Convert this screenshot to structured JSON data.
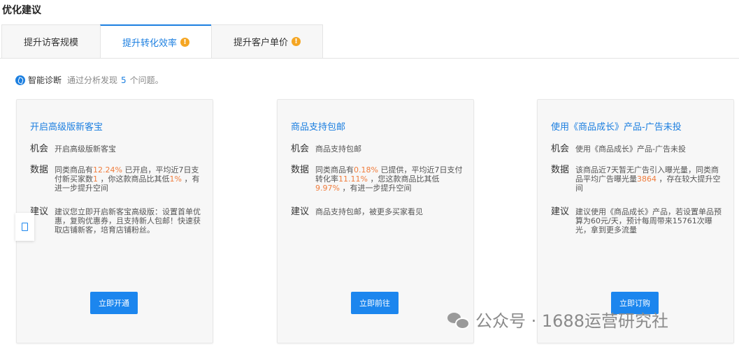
{
  "page_title": "优化建议",
  "tabs": [
    {
      "label": "提升访客规模",
      "warning": ""
    },
    {
      "label": "提升转化效率",
      "warning": "!"
    },
    {
      "label": "提升客户单价",
      "warning": "!"
    }
  ],
  "active_tab_index": 1,
  "diagnosis": {
    "label": "智能诊断",
    "prefix": "通过分析发现",
    "count": "5",
    "suffix": "个问题。",
    "icon": "smart-diagnosis-icon"
  },
  "labels": {
    "opportunity": "机会",
    "data": "数据",
    "suggestion": "建议"
  },
  "cards": [
    {
      "title": "开启高级版新客宝",
      "opportunity": "开启高级版新客宝",
      "data": [
        {
          "t": "同类商品有"
        },
        {
          "t": "12.24%",
          "hl": true
        },
        {
          "t": " 已开启，平均近7日支付新买家数"
        },
        {
          "t": "1",
          "hl": true
        },
        {
          "t": " ，你这款商品比其低"
        },
        {
          "t": "1%",
          "hl": true
        },
        {
          "t": " ，有进一步提升空间"
        }
      ],
      "suggestion": "建议您立即开启新客宝高级版：设置首单优惠，复购优惠券，且支持新人包邮！快速获取店铺新客，培育店铺粉丝。",
      "button": "立即开通"
    },
    {
      "title": "商品支持包邮",
      "opportunity": "商品支持包邮",
      "data": [
        {
          "t": "同类商品有"
        },
        {
          "t": "0.18%",
          "hl": true
        },
        {
          "t": " 已提供，平均近7日支付转化率"
        },
        {
          "t": "11.11%",
          "hl": true
        },
        {
          "t": " ，您这款商品比其低"
        },
        {
          "t": "9.97%",
          "hl": true
        },
        {
          "t": " ，有进一步提升空间"
        }
      ],
      "suggestion": "商品支持包邮，被更多买家看见",
      "button": "立即前往"
    },
    {
      "title": "使用《商品成长》产品-广告未投",
      "opportunity": "使用《商品成长》产品-广告未投",
      "data": [
        {
          "t": "该商品近7天暂无广告引入曝光量，同类商品平均广告曝光量"
        },
        {
          "t": "3864",
          "hl": true
        },
        {
          "t": " ，存在较大提升空间"
        }
      ],
      "suggestion": "建议使用《商品成长》产品，若设置单品预算为60元/天，预计每周带来15761次曝光，拿到更多流量",
      "button": "立即订购"
    }
  ],
  "watermark": "公众号 · 1688运营研究社",
  "colors": {
    "accent": "#1c7fe0",
    "highlight": "#f07c3c",
    "warning": "#f5a623",
    "button": "#1c86ee"
  }
}
